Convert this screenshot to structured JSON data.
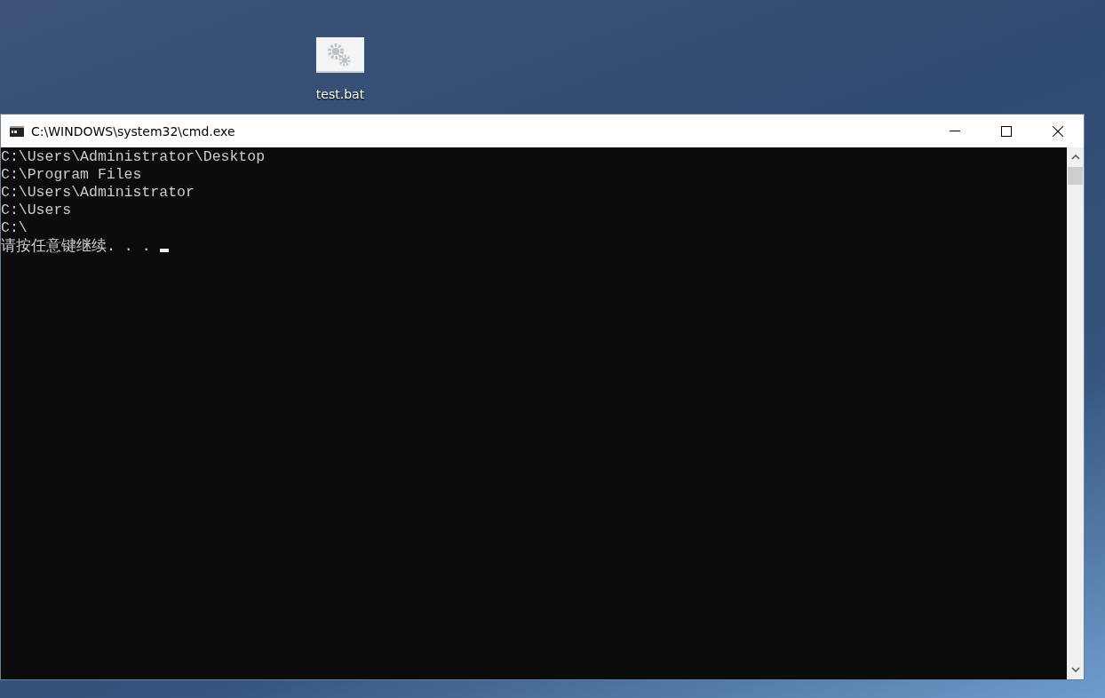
{
  "desktop": {
    "icons": [
      {
        "label": "test.bat"
      }
    ]
  },
  "window": {
    "title": "C:\\WINDOWS\\system32\\cmd.exe"
  },
  "console": {
    "lines": [
      "C:\\Users\\Administrator\\Desktop",
      "C:\\Program Files",
      "C:\\Users\\Administrator",
      "C:\\Users",
      "C:\\"
    ],
    "prompt": "请按任意键继续. . . "
  }
}
